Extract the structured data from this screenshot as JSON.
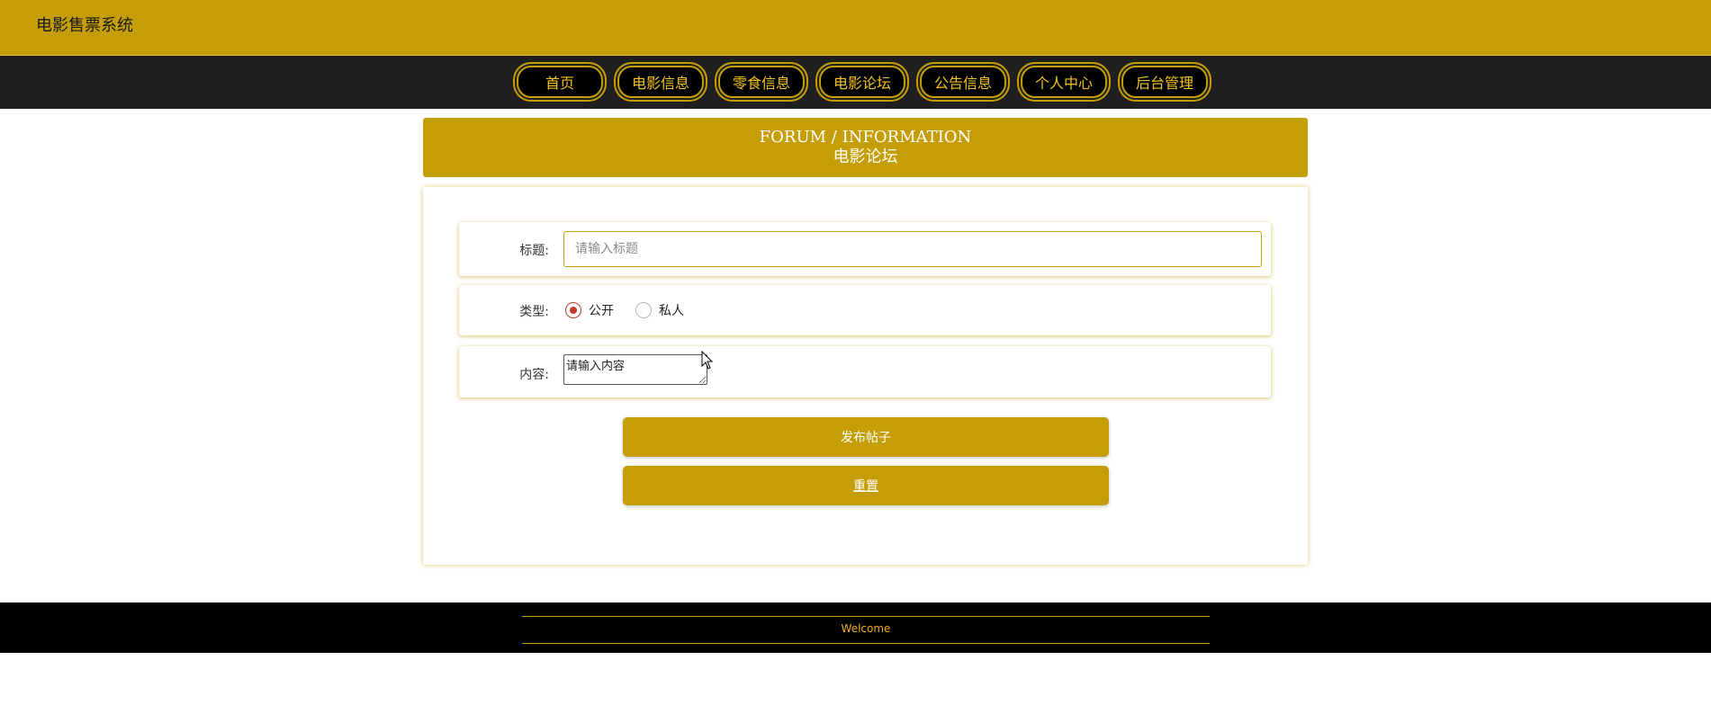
{
  "header": {
    "site_title": "电影售票系统"
  },
  "nav": {
    "items": [
      {
        "label": "首页"
      },
      {
        "label": "电影信息"
      },
      {
        "label": "零食信息"
      },
      {
        "label": "电影论坛"
      },
      {
        "label": "公告信息"
      },
      {
        "label": "个人中心"
      },
      {
        "label": "后台管理"
      }
    ]
  },
  "banner": {
    "title_en": "FORUM / INFORMATION",
    "title_cn": "电影论坛"
  },
  "form": {
    "title_label": "标题:",
    "title_placeholder": "请输入标题",
    "title_value": "",
    "type_label": "类型:",
    "type_options": [
      {
        "label": "公开",
        "checked": true
      },
      {
        "label": "私人",
        "checked": false
      }
    ],
    "content_label": "内容:",
    "content_placeholder": "请输入内容",
    "submit_label": "发布帖子",
    "reset_label": "重置"
  },
  "footer": {
    "text": "Welcome"
  },
  "colors": {
    "brand_gold": "#c59e07",
    "nav_dark": "#1f1f1f",
    "footer_black": "#000000",
    "radio_red": "#c0392b"
  },
  "icons": {
    "cursor": "mouse-pointer-icon"
  }
}
